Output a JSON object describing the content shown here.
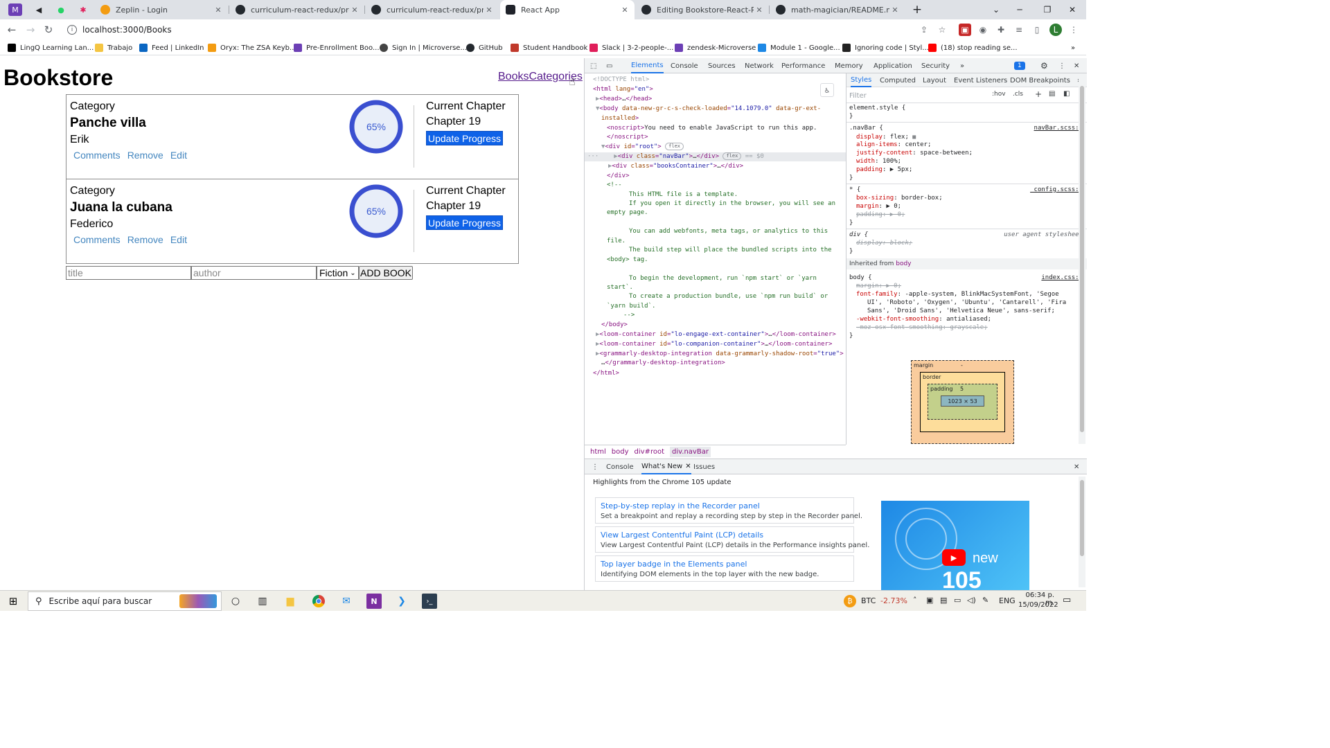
{
  "browser": {
    "tabs": [
      {
        "label": "Zeplin - Login"
      },
      {
        "label": "curriculum-react-redux/project_i"
      },
      {
        "label": "curriculum-react-redux/project_"
      },
      {
        "label": "React App"
      },
      {
        "label": "Editing Bookstore-React-Redux/F"
      },
      {
        "label": "math-magician/README.md at d"
      }
    ],
    "url": "localhost:3000/Books",
    "bookmarks": [
      {
        "label": "LingQ Learning Lan...",
        "color": "#000000"
      },
      {
        "label": "Trabajo",
        "color": "#f4c542"
      },
      {
        "label": "Feed | LinkedIn",
        "color": "#0a66c2"
      },
      {
        "label": "Oryx: The ZSA Keyb...",
        "color": "#f39c12"
      },
      {
        "label": "Pre-Enrollment Boo...",
        "color": "#6c3fb5"
      },
      {
        "label": "Sign In | Microverse...",
        "color": "#444444"
      },
      {
        "label": "GitHub",
        "color": "#24292f"
      },
      {
        "label": "Student Handbook",
        "color": "#c0392b"
      },
      {
        "label": "Slack | 3-2-people-...",
        "color": "#e01e5a"
      },
      {
        "label": "zendesk-Microverse",
        "color": "#6c3fb5"
      },
      {
        "label": "Module 1 - Google...",
        "color": "#1e88e5"
      },
      {
        "label": "Ignoring code | Styl...",
        "color": "#222222"
      },
      {
        "label": "(18) stop reading se...",
        "color": "#ff0000"
      }
    ]
  },
  "app": {
    "brand": "Bookstore",
    "nav_books": "Books",
    "nav_categories": "Categories",
    "books": [
      {
        "category": "Category",
        "title": "Panche villa",
        "author": "Erik",
        "progress": 65,
        "percent_label": "65%",
        "current_chapter_label": "Current Chapter",
        "chapter": "Chapter 19",
        "update_label": "Update Progress"
      },
      {
        "category": "Category",
        "title": "Juana la cubana",
        "author": "Federico",
        "progress": 65,
        "percent_label": "65%",
        "current_chapter_label": "Current Chapter",
        "chapter": "Chapter 19",
        "update_label": "Update Progress"
      }
    ],
    "actions": {
      "comments": "Comments",
      "remove": "Remove",
      "edit": "Edit"
    },
    "form": {
      "title_placeholder": "title",
      "author_placeholder": "author",
      "category_selected": "Fiction",
      "add_label": "ADD BOOK"
    }
  },
  "devtools": {
    "tabs": [
      "Elements",
      "Console",
      "Sources",
      "Network",
      "Performance",
      "Memory",
      "Application",
      "Security"
    ],
    "issues_count": "1",
    "styles_tabs": [
      "Styles",
      "Computed",
      "Layout",
      "Event Listeners",
      "DOM Breakpoints"
    ],
    "filter_placeholder": "Filter",
    "hov": ":hov",
    "cls": ".cls",
    "breadcrumbs": [
      "html",
      "body",
      "div#root",
      "div.navBar"
    ],
    "drawer_tabs": [
      "Console",
      "What's New",
      "Issues"
    ],
    "whats_new_title": "Highlights from the Chrome 105 update",
    "whats_new_items": [
      {
        "title": "Step-by-step replay in the Recorder panel",
        "desc": "Set a breakpoint and replay a recording step by step in the Recorder panel."
      },
      {
        "title": "View Largest Contentful Paint (LCP) details",
        "desc": "View Largest Contentful Paint (LCP) details in the Performance insights panel."
      },
      {
        "title": "Top layer badge in the Elements panel",
        "desc": "Identifying DOM elements in the top layer with the new badge."
      }
    ],
    "video_text": "new",
    "video_number": "105",
    "box_model": {
      "margin": "margin",
      "border": "border",
      "padding": "padding",
      "padding_value": "5",
      "content": "1023 × 53",
      "dash": "-"
    }
  },
  "taskbar": {
    "search_placeholder": "Escribe aquí para buscar",
    "btc_label": "BTC",
    "btc_change": "-2.73%",
    "lang": "ENG",
    "time": "06:34 p. m.",
    "date": "15/09/2022"
  },
  "colors": {
    "accent": "#0e62e8",
    "link": "#4386bf",
    "ring": "#3a5bd1",
    "visited": "#551a8b"
  }
}
